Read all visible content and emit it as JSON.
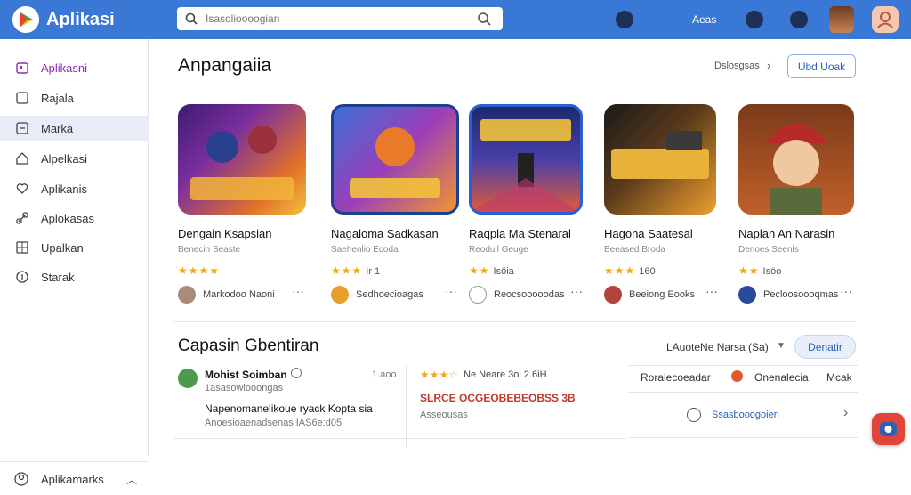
{
  "app": {
    "name": "Aplikasi"
  },
  "search": {
    "placeholder": "Isasolioooogian"
  },
  "header": {
    "link_label": "Aeas"
  },
  "sidebar": {
    "items": [
      {
        "label": "Aplikasni"
      },
      {
        "label": "Rajala"
      },
      {
        "label": "Marka"
      },
      {
        "label": "Alpelkasi"
      },
      {
        "label": "Aplikanis"
      },
      {
        "label": "Aplokasas"
      },
      {
        "label": "Upalkan"
      },
      {
        "label": "Starak"
      }
    ],
    "footer_label": "Aplikamarks"
  },
  "section1": {
    "title": "Anpangaiia",
    "see_more": "Dslosgsas",
    "button_label": "Ubd Uoak",
    "cards": [
      {
        "title": "Dengain Ksapsian",
        "subtitle": "Benecin Seaste",
        "stars": "★★★★",
        "rating": "",
        "developer": "Markodoo Naoni"
      },
      {
        "title": "Nagaloma Sadkasan",
        "subtitle": "Saehenlio Ecoda",
        "stars": "★★★",
        "rating": "Ir 1",
        "developer": "Sedhoecioagas"
      },
      {
        "title": "Raqpla Ma Stenaral",
        "subtitle": "Reoduil Geuge",
        "stars": "★★",
        "rating": "Isöia",
        "developer": "Reocsooooodas"
      },
      {
        "title": "Hagona Saatesal",
        "subtitle": "Beeased Broda",
        "stars": "★★★",
        "rating": "160",
        "developer": "Beeiong Eooks"
      },
      {
        "title": "Naplan An Narasin",
        "subtitle": "Denoes Seenls",
        "stars": "★★",
        "rating": "Isöo",
        "developer": "Pecloosoooqmas"
      }
    ]
  },
  "section2": {
    "title": "Capasin Gbentiran",
    "filter_label": "LAuoteNe Narsa (Sa)",
    "button_label": "Denatir",
    "review": {
      "name": "Mohist Soimban",
      "subline": "1asasowiooongas",
      "count": "1.aoo",
      "text": "Napenomanelikoue ryack Kopta sia",
      "subtext": "Anoesioaenadsenas IAS6e:d05"
    },
    "featured": {
      "rating_line": "Ne Neare 3oi 2.6iH",
      "headline": "SLRCE OCGEOBEBEOBSS 3B",
      "sub": "Asseousas"
    },
    "tabs": [
      "Roralecoeadar",
      "Onenalecia",
      "Mcak"
    ],
    "link_label": "Ssasbooogoien"
  }
}
